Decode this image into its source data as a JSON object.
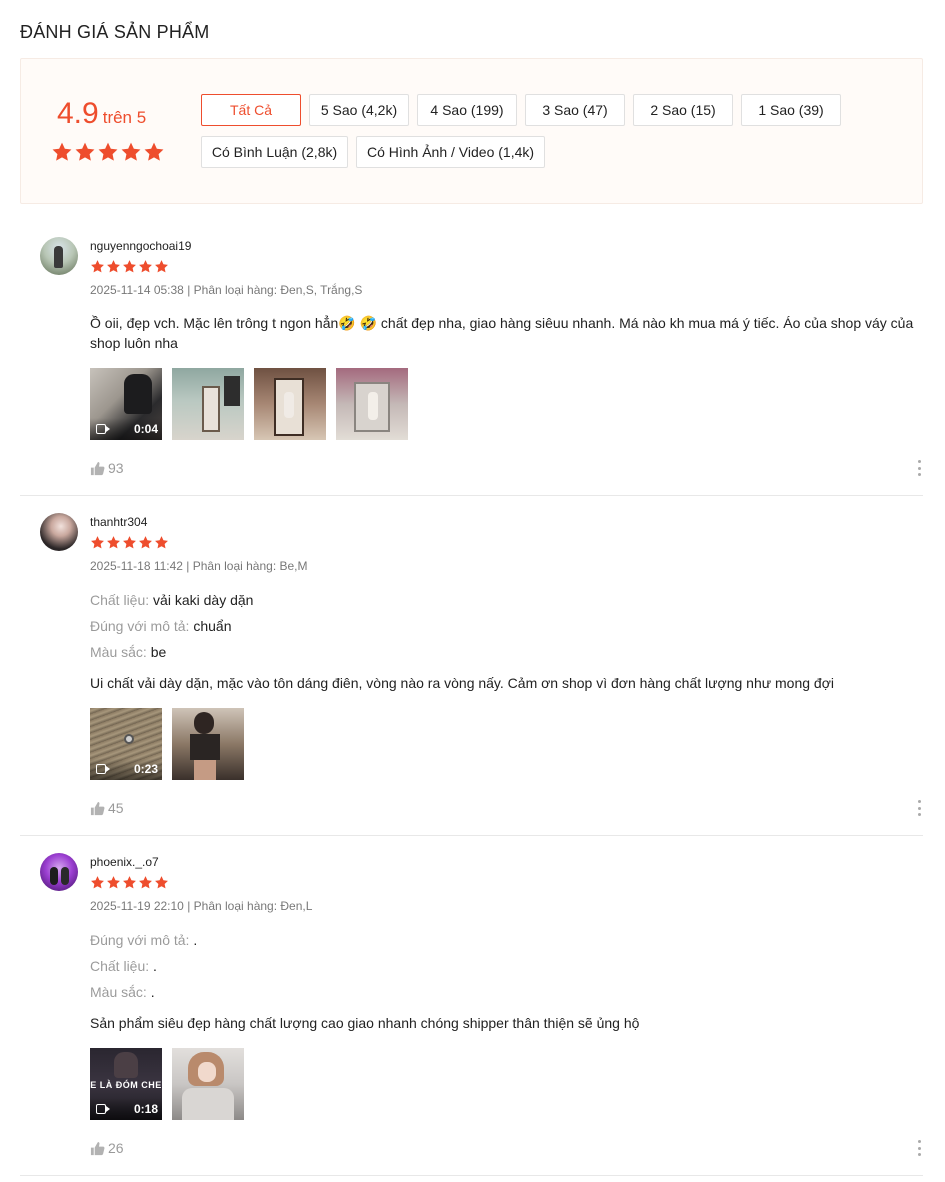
{
  "section_title": "ĐÁNH GIÁ SẢN PHẨM",
  "overview": {
    "score": "4.9",
    "score_suffix": "trên 5",
    "rating_stars": 5,
    "accent_color": "#ee4d2d",
    "filters": [
      "Tất Cả",
      "5 Sao (4,2k)",
      "4 Sao (199)",
      "3 Sao (47)",
      "2 Sao (15)",
      "1 Sao (39)",
      "Có Bình Luận (2,8k)",
      "Có Hình Ảnh / Video (1,4k)"
    ],
    "active_filter": "Tất Cả"
  },
  "reviews": [
    {
      "username": "nguyenngochoai19",
      "rating": 5,
      "meta": "2025-11-14 05:38 | Phân loại hàng: Đen,S, Trắng,S",
      "attributes": [],
      "comment": "Ồ oii, đẹp vch. Mặc lên trông t ngon hẳn🤣 🤣 chất đẹp nha, giao hàng siêuu nhanh. Má nào kh mua má ý tiếc. Áo của shop váy của shop luôn nha",
      "video_duration": "0:04",
      "media_icons": [
        "video-camera-icon"
      ],
      "likes": "93"
    },
    {
      "username": "thanhtr304",
      "rating": 5,
      "meta": "2025-11-18 11:42 | Phân loại hàng: Be,M",
      "attributes": [
        {
          "key": "Chất liệu:",
          "value": "vải kaki dày dặn"
        },
        {
          "key": "Đúng với mô tả:",
          "value": "chuẩn"
        },
        {
          "key": "Màu sắc:",
          "value": "be"
        }
      ],
      "comment": "Ui chất vải dày dặn, mặc vào tôn dáng điên, vòng nào ra vòng nấy. Cảm ơn shop vì đơn hàng chất lượng như mong đợi",
      "video_duration": "0:23",
      "likes": "45"
    },
    {
      "username": "phoenix._.o7",
      "rating": 5,
      "meta": "2025-11-19 22:10 | Phân loại hàng: Đen,L",
      "attributes": [
        {
          "key": "Đúng với mô tả:",
          "value": "."
        },
        {
          "key": "Chất liệu:",
          "value": "."
        },
        {
          "key": "Màu sắc:",
          "value": "."
        }
      ],
      "comment": "Sản phẩm siêu đẹp hàng chất lượng cao giao nhanh chóng shipper thân thiện sẽ ủng hộ",
      "video_duration": "0:18",
      "video_overlay_text": "E LÀ ĐÓM CHE",
      "likes": "26"
    }
  ]
}
